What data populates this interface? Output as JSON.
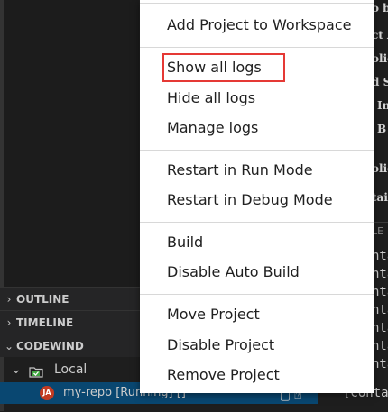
{
  "sidebar": {
    "sections": [
      {
        "label": "OUTLINE",
        "chevron": "›"
      },
      {
        "label": "TIMELINE",
        "chevron": "›"
      },
      {
        "label": "CODEWIND",
        "chevron": "⌄"
      }
    ],
    "local": {
      "chevron": "⌄",
      "label": "Local",
      "icon": "folder-check-icon"
    },
    "project": {
      "badge": "JA",
      "label": "my-repo [Running] []",
      "icons": "▢ ⍰"
    }
  },
  "context_menu": {
    "items": [
      "Add Project to Workspace",
      "Show all logs",
      "Hide all logs",
      "Manage logs",
      "Restart in Run Mode",
      "Restart in Debug Mode",
      "Build",
      "Disable Auto Build",
      "Move Project",
      "Disable Project",
      "Remove Project"
    ]
  },
  "right_panel": {
    "lines": [
      "o b",
      "ct A",
      "olic",
      "d S",
      "In",
      "B",
      "olic",
      "tai",
      "LE"
    ],
    "mono_lines": [
      "nta",
      "nta",
      "nta",
      "nta",
      "nta",
      "nta",
      "nta",
      "nta"
    ],
    "bottom": "[Conta"
  },
  "colors": {
    "highlight": "#e53935",
    "selection": "#094771"
  }
}
